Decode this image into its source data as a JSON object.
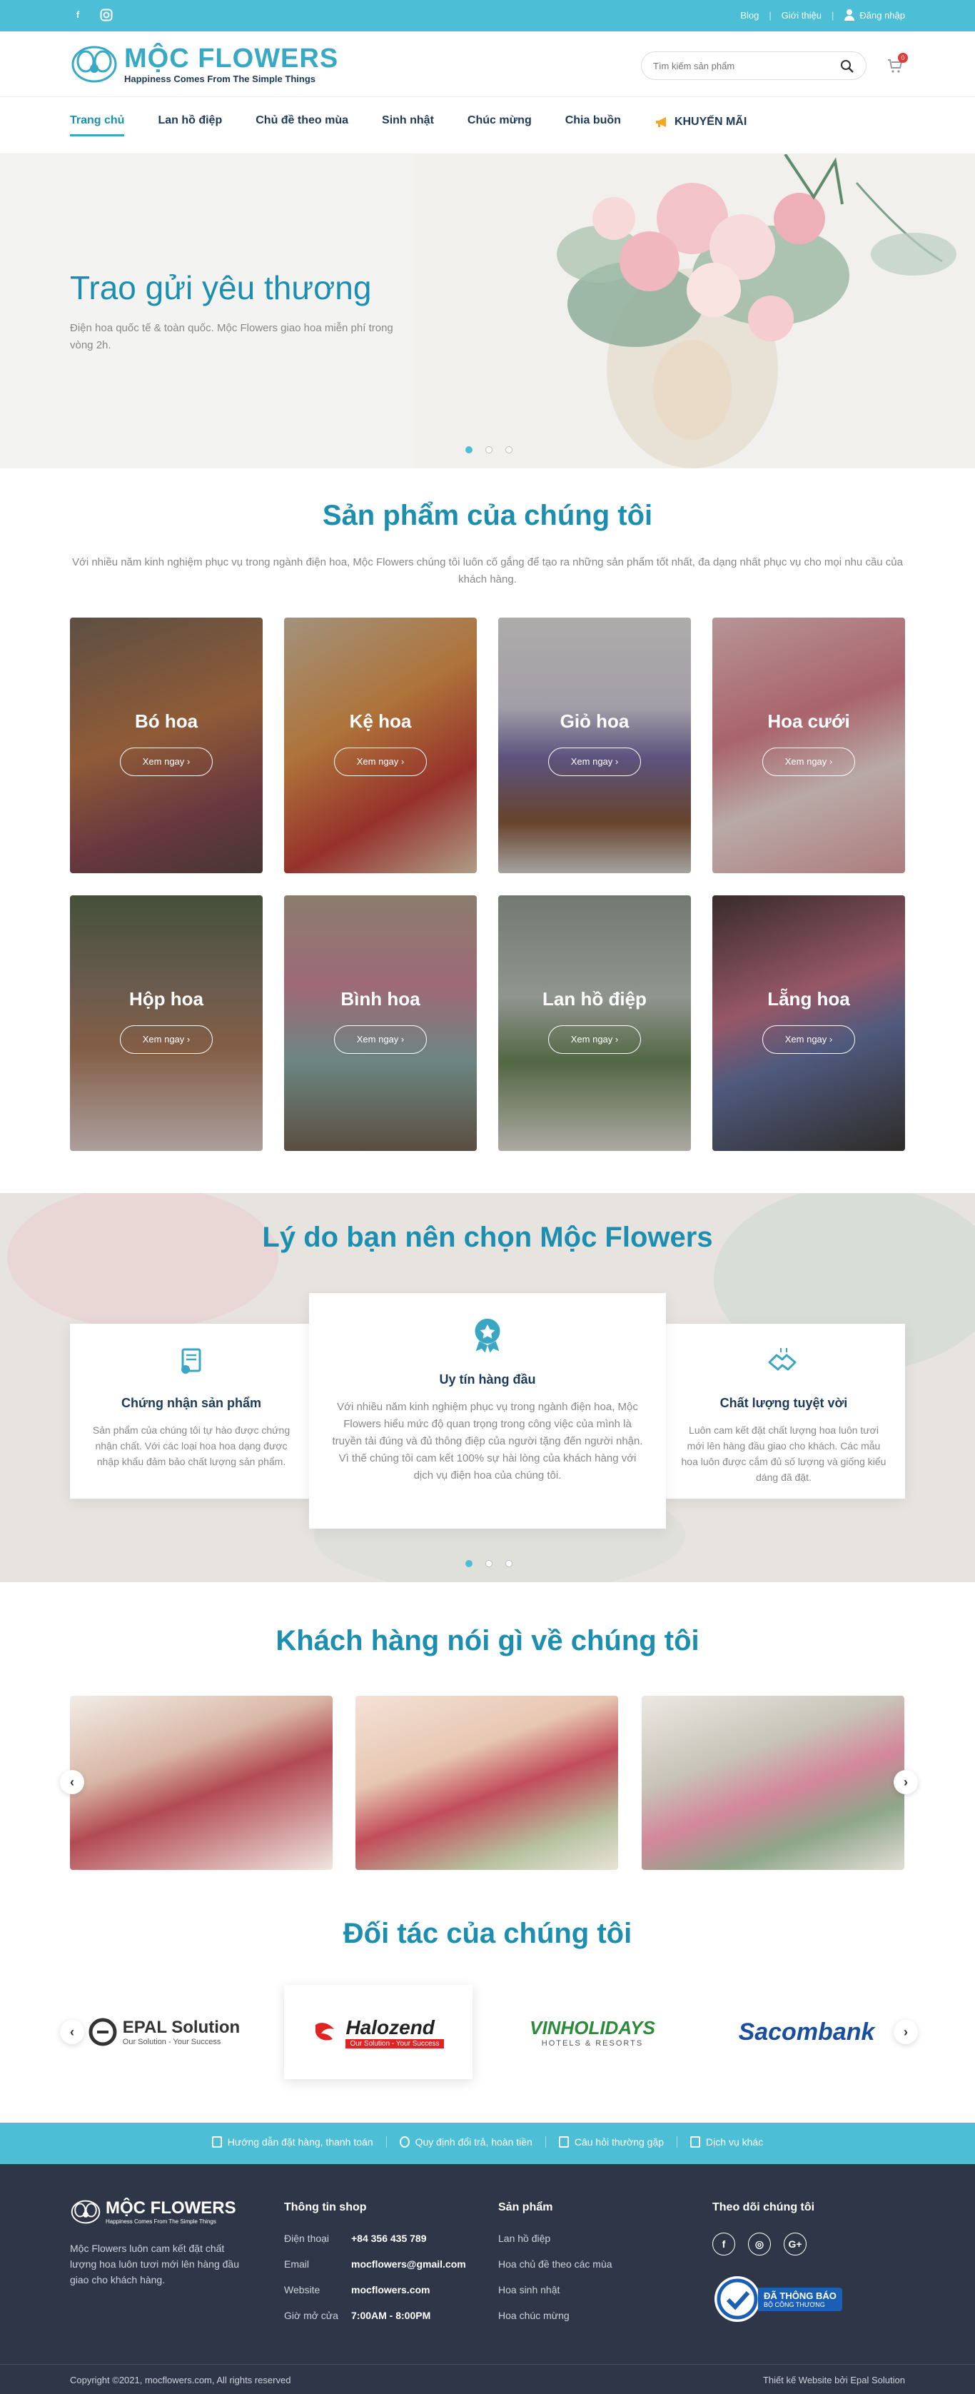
{
  "topbar": {
    "social": [
      "facebook-icon",
      "instagram-icon"
    ],
    "links": [
      "Blog",
      "Giới thiệu"
    ],
    "login": "Đăng nhập"
  },
  "header": {
    "brand": "MỘC FLOWERS",
    "tagline": "Happiness Comes From The Simple Things",
    "search_placeholder": "Tìm kiếm sản phẩm",
    "cart_count": "0"
  },
  "nav": [
    "Trang chủ",
    "Lan hồ điệp",
    "Chủ đề theo mùa",
    "Sinh nhật",
    "Chúc mừng",
    "Chia buồn",
    "KHUYẾN MÃI"
  ],
  "hero": {
    "title": "Trao gửi yêu thương",
    "text": "Điện hoa quốc tế & toàn quốc. Mộc Flowers giao hoa miễn phí trong vòng 2h."
  },
  "products": {
    "title": "Sản phẩm của chúng tôi",
    "desc": "Với nhiều năm kinh nghiệm phục vụ trong ngành điện hoa, Mộc Flowers chúng tôi luôn cố gắng để tạo ra những sản phẩm tốt nhất, đa dạng nhất phục vụ cho mọi nhu cầu của khách hàng.",
    "button_label": "Xem ngay",
    "items": [
      "Bó hoa",
      "Kệ hoa",
      "Giỏ hoa",
      "Hoa cưới",
      "Hộp hoa",
      "Bình hoa",
      "Lan hồ điệp",
      "Lẵng hoa"
    ]
  },
  "reasons": {
    "title": "Lý do bạn nên chọn Mộc Flowers",
    "items": [
      {
        "title": "Chứng nhận sản phẩm",
        "text": "Sản phẩm của chúng tôi tự hào được chứng nhận chất. Với các loại hoa hoa dạng được nhập khẩu đảm bảo chất lượng sản phẩm."
      },
      {
        "title": "Uy tín hàng đầu",
        "text": "Với nhiều năm kinh nghiệm phục vụ trong ngành điện hoa, Mộc Flowers hiểu mức độ quan trọng trong công việc của mình là truyền tải đúng và đủ thông điệp của người tặng đến người nhận. Vì thế chúng tôi cam kết 100% sự hài lòng của khách hàng với dịch vụ điện hoa của chúng tôi."
      },
      {
        "title": "Chất lượng tuyệt vời",
        "text": "Luôn cam kết đặt chất lượng hoa luôn tươi mới lên hàng đầu giao cho khách. Các mẫu hoa luôn được cắm đủ số lượng và giống kiểu dáng đã đặt."
      }
    ]
  },
  "testimonials": {
    "title": "Khách hàng nói gì về chúng tôi"
  },
  "partners": {
    "title": "Đối tác của chúng tôi",
    "items": [
      {
        "name": "EPAL Solution",
        "sub": "Our Solution - Your Success"
      },
      {
        "name": "Halozend",
        "sub": "Our Solution - Your Success"
      },
      {
        "name": "VINHOLIDAYS",
        "sub": "HOTELS & RESORTS"
      },
      {
        "name": "Sacombank",
        "sub": ""
      }
    ]
  },
  "infobar": [
    "Hướng dẫn đặt hàng, thanh toán",
    "Quy định đổi trả, hoàn tiền",
    "Câu hỏi thường gặp",
    "Dịch vụ khác"
  ],
  "footer": {
    "about": "Mộc Flowers luôn cam kết đặt chất lượng hoa luôn tươi mới lên hàng đầu giao cho khách hàng.",
    "shop_title": "Thông tin shop",
    "shop": [
      {
        "k": "Điện thoại",
        "v": "+84 356 435 789"
      },
      {
        "k": "Email",
        "v": "mocflowers@gmail.com"
      },
      {
        "k": "Website",
        "v": "mocflowers.com"
      },
      {
        "k": "Giờ mở cửa",
        "v": "7:00AM - 8:00PM"
      }
    ],
    "products_title": "Sản phẩm",
    "products": [
      "Lan hồ điệp",
      "Hoa chủ đề theo các mùa",
      "Hoa sinh nhật",
      "Hoa chúc mừng"
    ],
    "follow_title": "Theo dõi chúng tôi",
    "badge_line1": "ĐÃ THÔNG BÁO",
    "badge_line2": "BỘ CÔNG THƯƠNG",
    "copyright": "Copyright ©2021, mocflowers.com, All rights reserved",
    "credit": "Thiết kế Website bởi Epal Solution"
  }
}
